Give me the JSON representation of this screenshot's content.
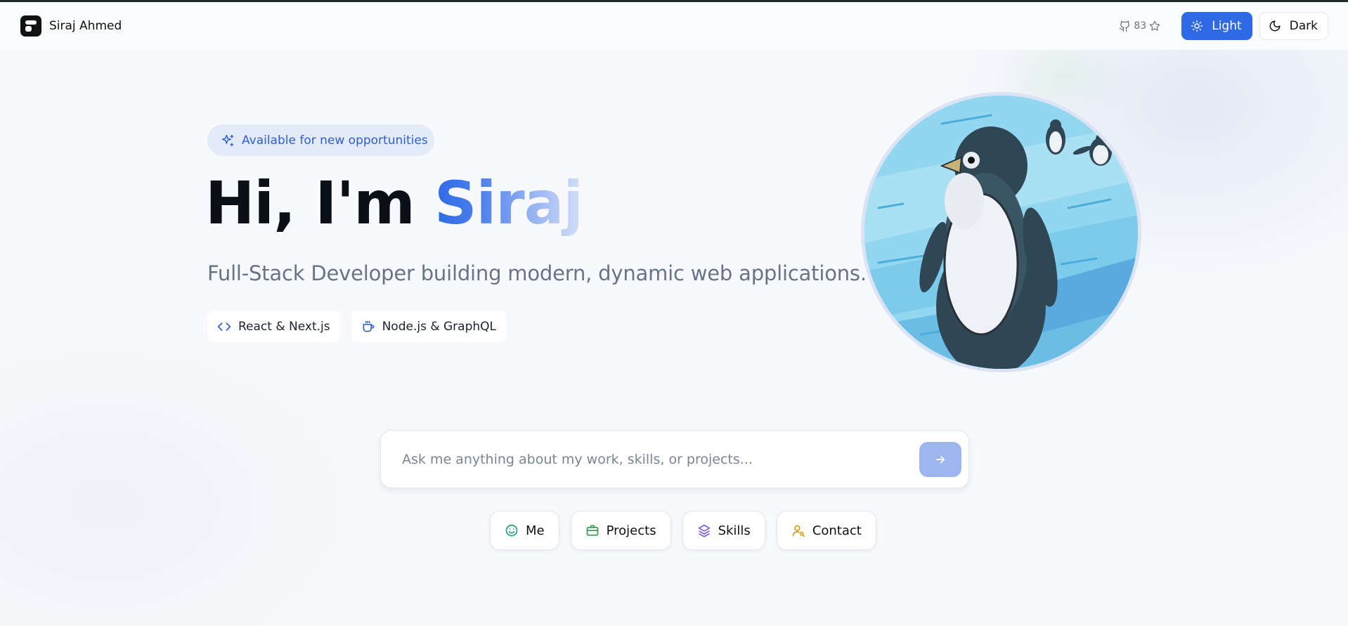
{
  "header": {
    "brand_name": "Siraj Ahmed",
    "github_stars": "83",
    "theme_light_label": "Light",
    "theme_dark_label": "Dark"
  },
  "hero": {
    "badge_text": "Available for new opportunities",
    "greeting": "Hi, I'm",
    "name": "Siraj",
    "subtitle": "Full-Stack Developer building modern, dynamic web applications.",
    "tags": [
      {
        "label": "React & Next.js",
        "icon": "code-icon"
      },
      {
        "label": "Node.js & GraphQL",
        "icon": "coffee-cup-icon"
      }
    ]
  },
  "chat": {
    "placeholder": "Ask me anything about my work, skills, or projects...",
    "send_icon": "arrow-right-icon"
  },
  "quick_actions": [
    {
      "label": "Me",
      "icon": "smile-icon",
      "color": "#1f9e7a"
    },
    {
      "label": "Projects",
      "icon": "briefcase-icon",
      "color": "#2f9a4e"
    },
    {
      "label": "Skills",
      "icon": "layers-icon",
      "color": "#7a5cd6"
    },
    {
      "label": "Contact",
      "icon": "user-search-icon",
      "color": "#d99a1a"
    }
  ],
  "colors": {
    "accent": "#2f6ae6",
    "badge_bg": "#e3eaf8",
    "send_disabled": "#9db6f2"
  }
}
